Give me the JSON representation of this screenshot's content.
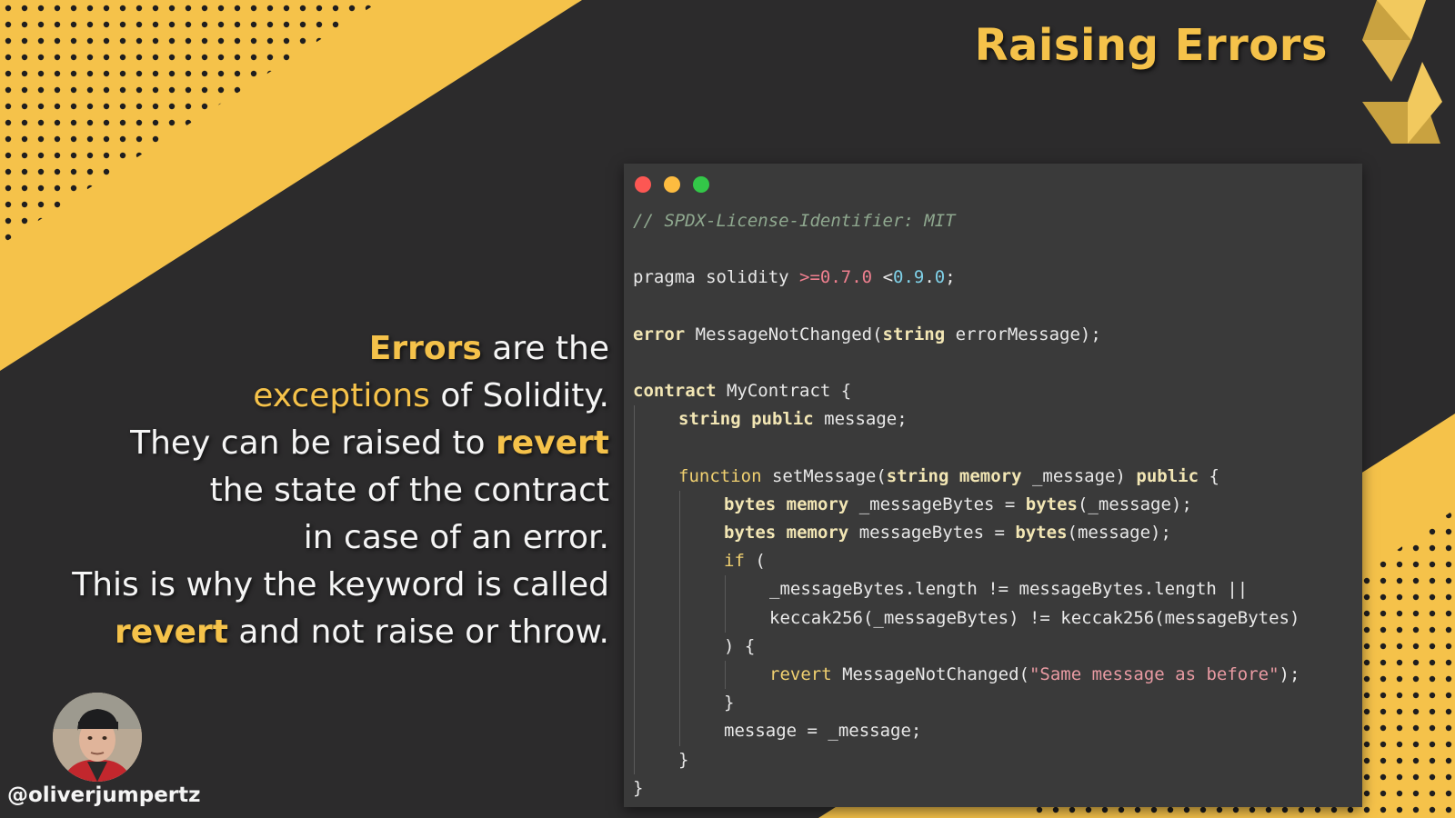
{
  "title": "Raising Errors",
  "description": [
    [
      {
        "text": "Errors",
        "style": "hl-b"
      },
      {
        "text": " are the",
        "style": ""
      }
    ],
    [
      {
        "text": "exceptions",
        "style": "hl"
      },
      {
        "text": " of Solidity.",
        "style": ""
      }
    ],
    [
      {
        "text": "They can be raised to ",
        "style": ""
      },
      {
        "text": "revert",
        "style": "hl-b"
      }
    ],
    [
      {
        "text": "the state of the contract",
        "style": ""
      }
    ],
    [
      {
        "text": "in case of an error.",
        "style": ""
      }
    ],
    [
      {
        "text": "This is why the keyword is called",
        "style": ""
      }
    ],
    [
      {
        "text": "revert",
        "style": "hl-b"
      },
      {
        "text": " and not raise or throw.",
        "style": ""
      }
    ]
  ],
  "author": {
    "handle": "@oliverjumpertz",
    "avatar_icon": "avatar-photo"
  },
  "window_controls": [
    "close",
    "minimize",
    "maximize"
  ],
  "colors": {
    "accent": "#f5c24a",
    "background": "#2c2b2c",
    "code_bg": "#3a3a3a"
  },
  "code_lines": [
    {
      "indent": 0,
      "tokens": [
        [
          "// SPDX-License-Identifier: MIT",
          "t-cmt"
        ]
      ]
    },
    {
      "indent": 0,
      "tokens": []
    },
    {
      "indent": 0,
      "tokens": [
        [
          "pragma solidity ",
          "t-pl"
        ],
        [
          ">=",
          "t-op"
        ],
        [
          "0.7.0",
          "t-num1"
        ],
        [
          " <",
          "t-pl"
        ],
        [
          "0.9",
          "t-num2"
        ],
        [
          ".",
          "t-pl"
        ],
        [
          "0",
          "t-num2"
        ],
        [
          ";",
          "t-pl"
        ]
      ]
    },
    {
      "indent": 0,
      "tokens": []
    },
    {
      "indent": 0,
      "tokens": [
        [
          "error",
          "t-kw"
        ],
        [
          " MessageNotChanged(",
          "t-pl"
        ],
        [
          "string",
          "t-kw"
        ],
        [
          " errorMessage);",
          "t-pl"
        ]
      ]
    },
    {
      "indent": 0,
      "tokens": []
    },
    {
      "indent": 0,
      "tokens": [
        [
          "contract",
          "t-kw"
        ],
        [
          " MyContract {",
          "t-pl"
        ]
      ]
    },
    {
      "indent": 1,
      "tokens": [
        [
          "string",
          "t-kw"
        ],
        [
          " ",
          "t-pl"
        ],
        [
          "public",
          "t-kw"
        ],
        [
          " message;",
          "t-pl"
        ]
      ]
    },
    {
      "indent": 1,
      "tokens": []
    },
    {
      "indent": 1,
      "tokens": [
        [
          "function",
          "t-fn"
        ],
        [
          " setMessage(",
          "t-pl"
        ],
        [
          "string",
          "t-kw"
        ],
        [
          " ",
          "t-pl"
        ],
        [
          "memory",
          "t-kw"
        ],
        [
          " _message) ",
          "t-pl"
        ],
        [
          "public",
          "t-kw"
        ],
        [
          " {",
          "t-pl"
        ]
      ]
    },
    {
      "indent": 2,
      "tokens": [
        [
          "bytes",
          "t-kw"
        ],
        [
          " ",
          "t-pl"
        ],
        [
          "memory",
          "t-kw"
        ],
        [
          " _messageBytes = ",
          "t-pl"
        ],
        [
          "bytes",
          "t-kw"
        ],
        [
          "(_message);",
          "t-pl"
        ]
      ]
    },
    {
      "indent": 2,
      "tokens": [
        [
          "bytes",
          "t-kw"
        ],
        [
          " ",
          "t-pl"
        ],
        [
          "memory",
          "t-kw"
        ],
        [
          " messageBytes = ",
          "t-pl"
        ],
        [
          "bytes",
          "t-kw"
        ],
        [
          "(message);",
          "t-pl"
        ]
      ]
    },
    {
      "indent": 2,
      "tokens": [
        [
          "if",
          "t-fn"
        ],
        [
          " (",
          "t-pl"
        ]
      ]
    },
    {
      "indent": 3,
      "tokens": [
        [
          "_messageBytes.length != messageBytes.length ||",
          "t-pl"
        ]
      ]
    },
    {
      "indent": 3,
      "tokens": [
        [
          "keccak256(_messageBytes) != keccak256(messageBytes)",
          "t-pl"
        ]
      ]
    },
    {
      "indent": 2,
      "tokens": [
        [
          ") {",
          "t-pl"
        ]
      ]
    },
    {
      "indent": 3,
      "tokens": [
        [
          "revert",
          "t-fn"
        ],
        [
          " MessageNotChanged(",
          "t-pl"
        ],
        [
          "\"Same message as before\"",
          "t-str"
        ],
        [
          ");",
          "t-pl"
        ]
      ]
    },
    {
      "indent": 2,
      "tokens": [
        [
          "}",
          "t-pl"
        ]
      ]
    },
    {
      "indent": 2,
      "tokens": [
        [
          "message = _message;",
          "t-pl"
        ]
      ]
    },
    {
      "indent": 1,
      "tokens": [
        [
          "}",
          "t-pl"
        ]
      ]
    },
    {
      "indent": 0,
      "tokens": [
        [
          "}",
          "t-pl"
        ]
      ]
    }
  ]
}
